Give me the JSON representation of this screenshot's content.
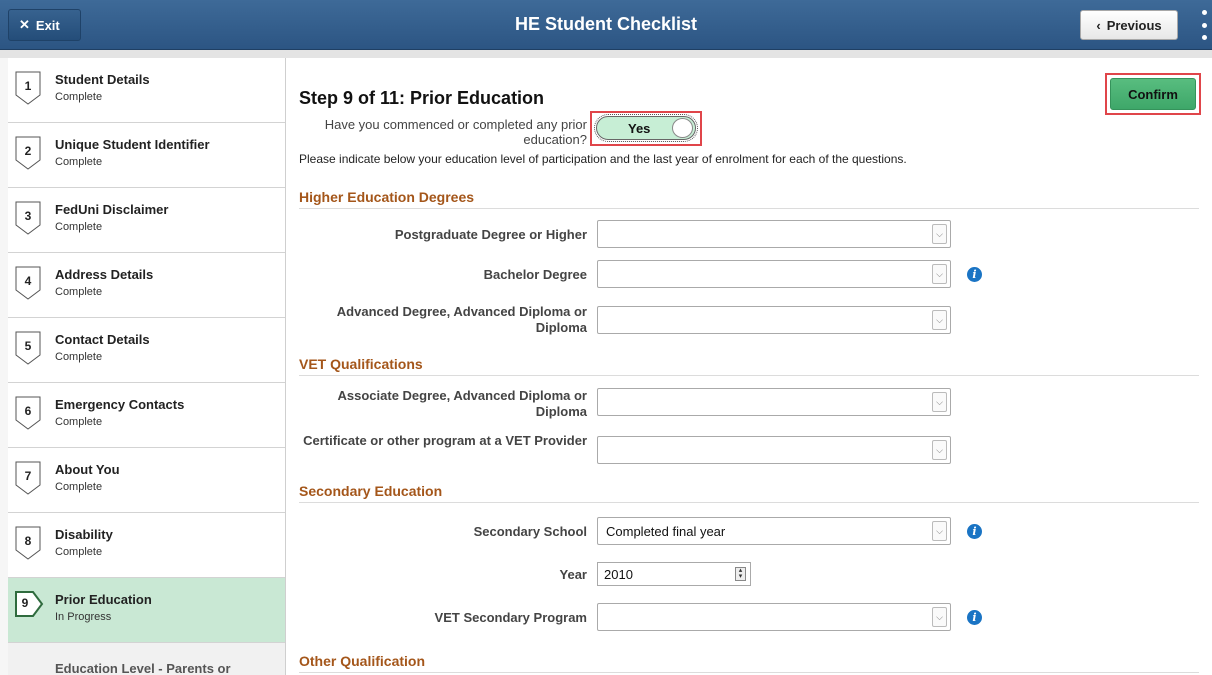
{
  "header": {
    "exit_label": "Exit",
    "title": "HE Student Checklist",
    "previous_label": "Previous"
  },
  "sidebar": {
    "steps": [
      {
        "num": "1",
        "title": "Student Details",
        "status": "Complete"
      },
      {
        "num": "2",
        "title": "Unique Student Identifier",
        "status": "Complete"
      },
      {
        "num": "3",
        "title": "FedUni Disclaimer",
        "status": "Complete"
      },
      {
        "num": "4",
        "title": "Address Details",
        "status": "Complete"
      },
      {
        "num": "5",
        "title": "Contact Details",
        "status": "Complete"
      },
      {
        "num": "6",
        "title": "Emergency Contacts",
        "status": "Complete"
      },
      {
        "num": "7",
        "title": "About You",
        "status": "Complete"
      },
      {
        "num": "8",
        "title": "Disability",
        "status": "Complete"
      },
      {
        "num": "9",
        "title": "Prior Education",
        "status": "In Progress"
      },
      {
        "num": "",
        "title": "Education Level - Parents or",
        "status": ""
      }
    ]
  },
  "main": {
    "confirm_label": "Confirm",
    "step_heading": "Step 9 of 11: Prior Education",
    "question": "Have you commenced or completed any prior education?",
    "toggle_value": "Yes",
    "instructions": "Please indicate below your education level of participation and the last year of enrolment for each of the questions.",
    "sections": {
      "higher_ed": {
        "title": "Higher Education Degrees",
        "postgrad_label": "Postgraduate Degree or Higher",
        "postgrad_value": "",
        "bachelor_label": "Bachelor Degree",
        "bachelor_value": "",
        "advdeg_label": "Advanced Degree, Advanced Diploma or Diploma",
        "advdeg_value": ""
      },
      "vet": {
        "title": "VET Qualifications",
        "assoc_label": "Associate Degree, Advanced Diploma or Diploma",
        "assoc_value": "",
        "cert_label": "Certificate or other program at a VET Provider",
        "cert_value": ""
      },
      "secondary": {
        "title": "Secondary Education",
        "school_label": "Secondary School",
        "school_value": "Completed final year",
        "year_label": "Year",
        "year_value": "2010",
        "vetsec_label": "VET Secondary Program",
        "vetsec_value": ""
      },
      "other": {
        "title": "Other Qualification"
      }
    }
  },
  "colors": {
    "header_bg": "#2c5583",
    "active_step_bg": "#c9e8d4",
    "confirm_bg": "#4db374",
    "section_title": "#a4561a",
    "highlight_border": "#e0454a",
    "info_icon": "#1a74c4"
  },
  "icons": {
    "exit": "close-icon",
    "previous": "chevron-left-icon",
    "more": "more-vertical-icon",
    "info": "info-icon",
    "dropdown": "chevron-down-icon"
  }
}
